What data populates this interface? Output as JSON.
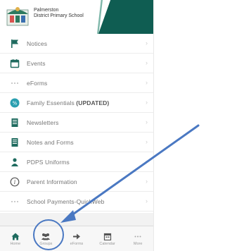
{
  "header": {
    "school_name_line1": "Palmerston",
    "school_name_line2": "District Primary School",
    "logo_icon": "school-logo-icon"
  },
  "menu": {
    "items": [
      {
        "label": "Notices",
        "icon": "flag-icon"
      },
      {
        "label": "Events",
        "icon": "calendar-icon"
      },
      {
        "label": "eForms",
        "icon": "dots-icon"
      },
      {
        "label": "Family Essentials",
        "label_suffix": "(UPDATED)",
        "icon": "percent-icon"
      },
      {
        "label": "Newsletters",
        "icon": "document-icon"
      },
      {
        "label": "Notes and Forms",
        "icon": "document-icon"
      },
      {
        "label": "PDPS Uniforms",
        "icon": "person-icon"
      },
      {
        "label": "Parent Information",
        "icon": "info-icon"
      },
      {
        "label": "School Payments-QuickWeb",
        "icon": "dots-icon"
      }
    ],
    "chevron": "›"
  },
  "tabbar": {
    "tabs": [
      {
        "label": "Home",
        "icon": "home-icon"
      },
      {
        "label": "Groups",
        "icon": "groups-icon"
      },
      {
        "label": "eForms",
        "icon": "arrow-right-icon"
      },
      {
        "label": "Calendar",
        "icon": "calendar-icon"
      },
      {
        "label": "More",
        "icon": "more-icon"
      }
    ]
  },
  "colors": {
    "accent": "#0f5d52",
    "icon_green": "#1f6b5f",
    "icon_teal": "#2a9fb0",
    "annotation_blue": "#4a78c2"
  }
}
